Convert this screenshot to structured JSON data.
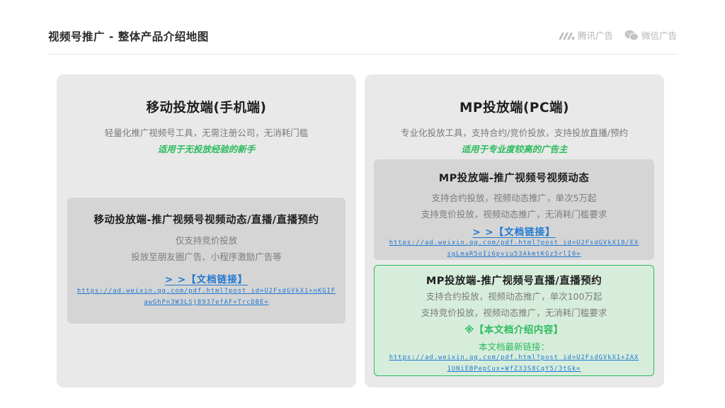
{
  "header": {
    "title": "视频号推广 - 整体产品介绍地图",
    "logo_tencent": "腾讯广告",
    "logo_wechat": "微信广告"
  },
  "left": {
    "title": "移动投放端(手机端)",
    "desc": "轻量化推广视频号工具，无需注册公司，无消耗门槛",
    "tag": "适用于无投放经验的新手",
    "card": {
      "title": "移动投放端-推广视频号视频动态/直播/直播预约",
      "line1": "仅支持竞价投放",
      "line2": "投放至朋友圈广告、小程序激励广告等",
      "link_label": "> >【文档链接】",
      "url_line1": "https://ad.weixin.qq.com/pdf.html?post_id=U2FsdGVkX1+nKGIF",
      "url_line2": "awGhPn3W3LSj8937efAF+TrcDBE="
    }
  },
  "right": {
    "title": "MP投放端(PC端)",
    "desc": "专业化投放工具，支持合约/竞价投放，支持投放直播/预约",
    "tag": "适用于专业度较高的广告主",
    "card1": {
      "title": "MP投放端-推广视频号视频动态",
      "line1": "支持合约投放，视频动态推广，单次5万起",
      "line2": "支持竞价投放，视频动态推广，无消耗门槛要求",
      "link_label": "> >【文档链接】",
      "url_line1": "https://ad.weixin.qq.com/pdf.html?post_id=U2FsdGVkX18/EX",
      "url_line2": "sgLmaR5oIi6pviu53AkmtKGz5rlI0="
    },
    "card2": {
      "title": "MP投放端-推广视频号直播/直播预约",
      "line1": "支持合约投放，视频动态推广，单次100万起",
      "line2": "支持竞价投放，视频动态推广，无消耗门槛要求",
      "note": "※【本文档介绍内容】",
      "latest": "本文档最新链接：",
      "url_line1": "https://ad.weixin.qq.com/pdf.html?post_id=U2FsdGVkX1+ZAX",
      "url_line2": "1UNiEBPepCux+WfZ33S8CqY5/3tGk="
    }
  },
  "colors": {
    "accent_green": "#2bbb5e",
    "link_blue": "#1f78d1"
  }
}
